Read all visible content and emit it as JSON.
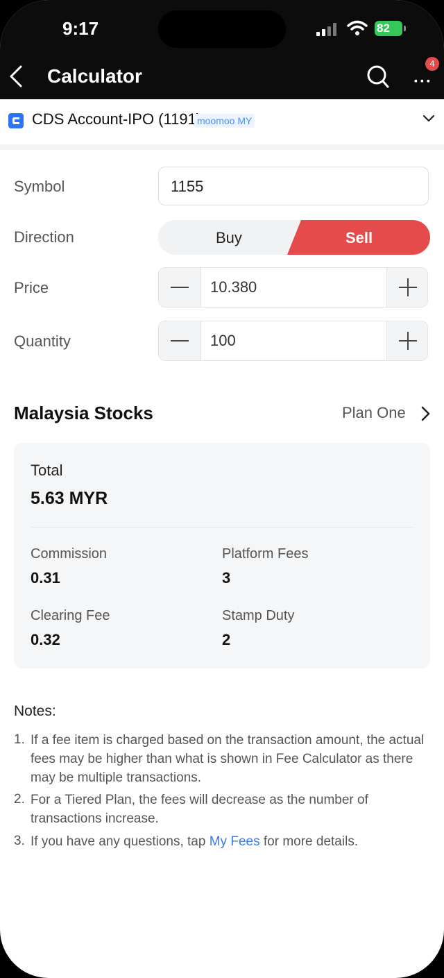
{
  "status_bar": {
    "time": "9:17",
    "battery": "82"
  },
  "header": {
    "title": "Calculator",
    "badge_count": "4",
    "more_label": "···"
  },
  "account": {
    "name": "CDS Account-IPO (1191)",
    "tag": "moomoo MY"
  },
  "form": {
    "symbol_label": "Symbol",
    "symbol_value": "1155",
    "direction_label": "Direction",
    "buy_label": "Buy",
    "sell_label": "Sell",
    "direction_selected": "Sell",
    "price_label": "Price",
    "price_value": "10.380",
    "quantity_label": "Quantity",
    "quantity_value": "100"
  },
  "fees": {
    "section_title": "Malaysia Stocks",
    "plan": "Plan One",
    "total_label": "Total",
    "total_value": "5.63 MYR",
    "commission_label": "Commission",
    "commission_value": "0.31",
    "platform_label": "Platform Fees",
    "platform_value": "3",
    "clearing_label": "Clearing Fee",
    "clearing_value": "0.32",
    "stamp_label": "Stamp Duty",
    "stamp_value": "2"
  },
  "notes": {
    "title": "Notes:",
    "items": [
      {
        "num": "1.",
        "text": "If a fee item is charged based on the transaction amount, the actual fees may be higher than what is shown in Fee Calculator as there may be multiple transactions."
      },
      {
        "num": "2.",
        "text": "For a Tiered Plan, the fees will decrease as the number of transactions increase."
      },
      {
        "num": "3.",
        "text_before": "If you have any questions, tap ",
        "link": "My Fees",
        "text_after": " for more details."
      }
    ]
  },
  "colors": {
    "accent": "#E54B4B",
    "link": "#3B7BE4",
    "header_bg": "#0C0C0C"
  }
}
